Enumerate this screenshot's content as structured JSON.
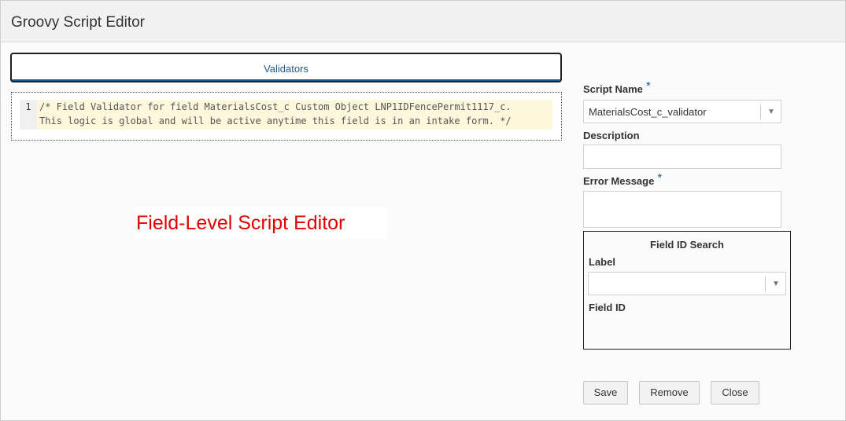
{
  "window": {
    "title": "Groovy Script Editor"
  },
  "tabs": [
    {
      "label": "Validators"
    }
  ],
  "code": {
    "line_numbers": [
      "1"
    ],
    "lines": [
      "/* Field Validator for field MaterialsCost_c Custom Object LNP1IDFencePermit1117_c.",
      "This logic is global and will be active anytime this field is in an intake form. */"
    ]
  },
  "annotation": {
    "text": "Field-Level Script Editor"
  },
  "form": {
    "script_name": {
      "label": "Script Name",
      "required_mark": "*",
      "value": "MaterialsCost_c_validator"
    },
    "description": {
      "label": "Description",
      "value": ""
    },
    "error_message": {
      "label": "Error Message",
      "required_mark": "*",
      "value": ""
    }
  },
  "field_id_search": {
    "title": "Field ID Search",
    "label_field": {
      "label": "Label",
      "value": ""
    },
    "field_id": {
      "label": "Field ID"
    }
  },
  "buttons": {
    "save": "Save",
    "remove": "Remove",
    "close": "Close"
  },
  "icons": {
    "dropdown": "chevron-down-icon",
    "dropdown_glyph": "▼"
  },
  "colors": {
    "accent": "#1f5b8f",
    "annotation": "#e00000",
    "code_bg": "#fdf8dc"
  }
}
